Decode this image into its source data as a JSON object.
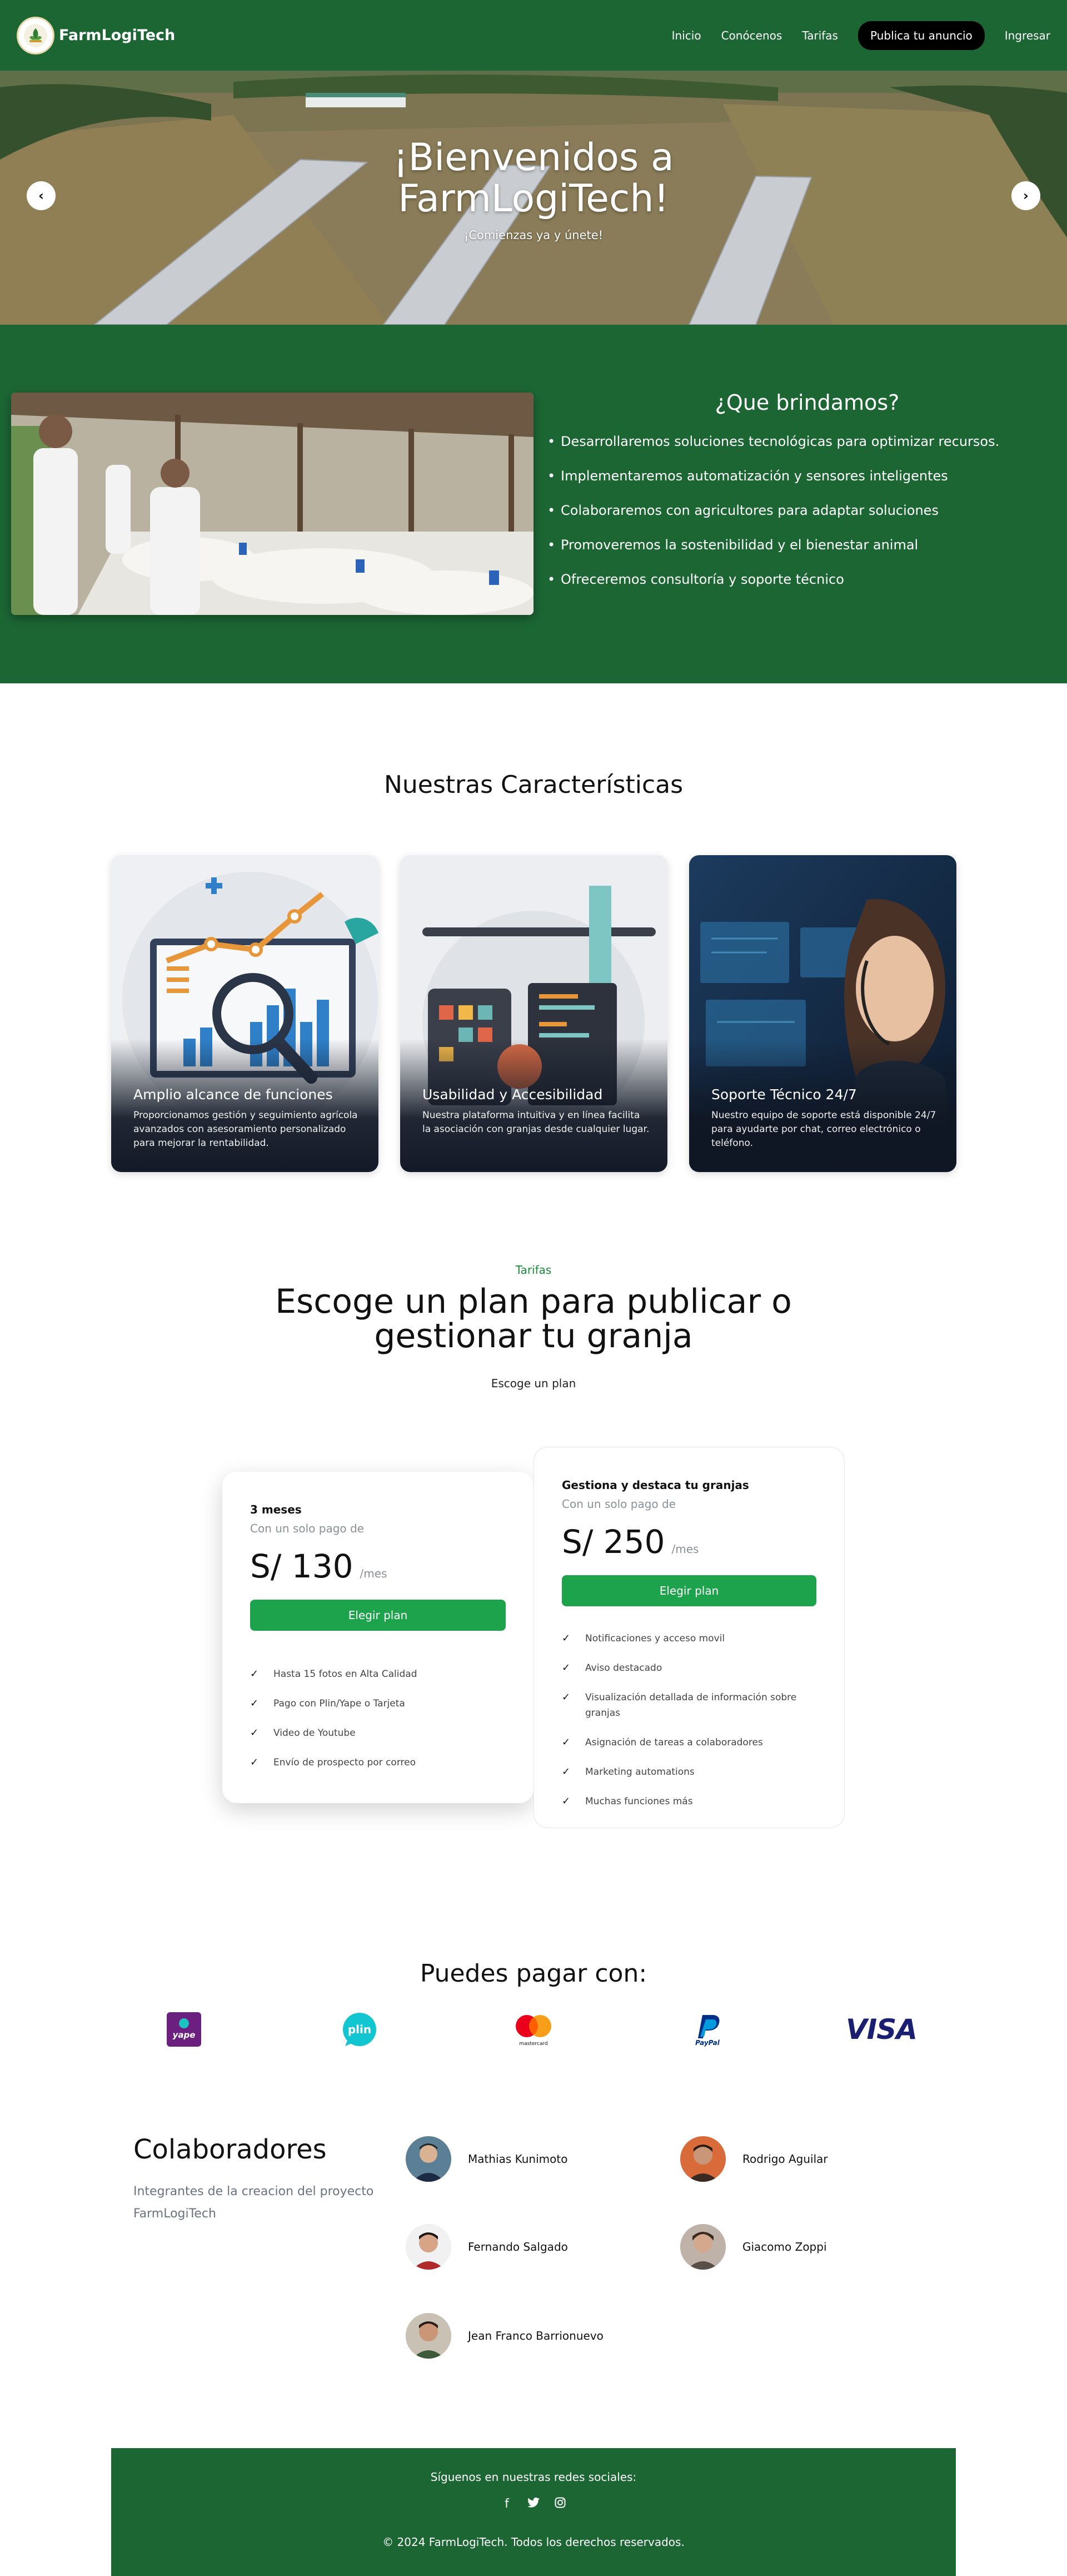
{
  "brand": {
    "name": "FarmLogiTech"
  },
  "nav": {
    "links": [
      "Inicio",
      "Conócenos",
      "Tarifas"
    ],
    "cta": "Publica tu anuncio",
    "login": "Ingresar"
  },
  "hero": {
    "title_line1": "¡Bienvenidos a",
    "title_line2": "FarmLogiTech!",
    "subtitle": "¡Comienzas ya y únete!",
    "prev_icon": "‹",
    "next_icon": "›"
  },
  "offer": {
    "title": "¿Que brindamos?",
    "items": [
      "Desarrollaremos soluciones tecnológicas para optimizar recursos.",
      "Implementaremos automatización y sensores inteligentes",
      "Colaboraremos con agricultores para adaptar soluciones",
      "Promoveremos la sostenibilidad y el bienestar animal",
      "Ofreceremos consultoría y soporte técnico"
    ]
  },
  "features": {
    "title": "Nuestras Características",
    "cards": [
      {
        "title": "Amplio alcance de funciones",
        "text": "Proporcionamos gestión y seguimiento agrícola avanzados con asesoramiento personalizado para mejorar la rentabilidad."
      },
      {
        "title": "Usabilidad y Accesibilidad",
        "text": "Nuestra plataforma intuitiva y en línea facilita la asociación con granjas desde cualquier lugar."
      },
      {
        "title": "Soporte Técnico 24/7",
        "text": "Nuestro equipo de soporte está disponible 24/7 para ayudarte por chat, correo electrónico o teléfono."
      }
    ]
  },
  "pricing": {
    "kicker": "Tarifas",
    "title_line1": "Escoge un plan para publicar o",
    "title_line2": "gestionar tu granja",
    "subtitle": "Escoge un plan",
    "plans": [
      {
        "name": "3 meses",
        "note": "Con un solo pago de",
        "price": "S/ 130",
        "period": "/mes",
        "button": "Elegir plan",
        "features": [
          "Hasta 15 fotos en Alta Calidad",
          "Pago con Plin/Yape o Tarjeta",
          "Video de Youtube",
          "Envío de prospecto por correo"
        ]
      },
      {
        "name": "Gestiona y destaca tu granjas",
        "note": "Con un solo pago de",
        "price": "S/ 250",
        "period": "/mes",
        "button": "Elegir plan",
        "features": [
          "Notificaciones y acceso movil",
          "Aviso destacado",
          "Visualización detallada de información sobre granjas",
          "Asignación de tareas a colaboradores",
          "Marketing automations",
          "Muchas funciones más"
        ]
      }
    ]
  },
  "payment": {
    "title": "Puedes pagar con:",
    "methods": [
      "yape",
      "plin",
      "mastercard",
      "PayPal",
      "VISA"
    ]
  },
  "team": {
    "title": "Colaboradores",
    "description": "Integrantes de la creacion del proyecto FarmLogiTech",
    "members": [
      "Mathias Kunimoto",
      "Rodrigo Aguilar",
      "Fernando Salgado",
      "Giacomo Zoppi",
      "Jean Franco Barrionuevo"
    ]
  },
  "footer": {
    "follow": "Síguenos en nuestras redes sociales:",
    "social": [
      "f",
      "🐦",
      "◎"
    ],
    "copyright": "© 2024 FarmLogiTech. Todos los derechos reservados."
  },
  "colors": {
    "primary_green": "#1c6634",
    "button_green": "#1da34c",
    "kicker_green": "#1a8a3a"
  }
}
